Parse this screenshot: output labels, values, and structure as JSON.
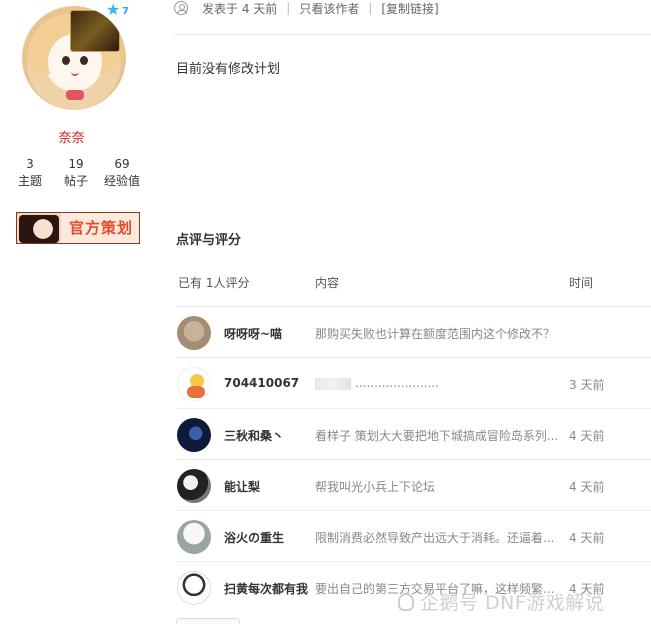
{
  "author": {
    "name": "奈奈",
    "level": "7",
    "stats": [
      {
        "value": "3",
        "label": "主题"
      },
      {
        "value": "19",
        "label": "帖子"
      },
      {
        "value": "69",
        "label": "经验值"
      }
    ],
    "medal_text": "官方策划"
  },
  "post": {
    "meta": {
      "posted": "发表于 4 天前",
      "only_author": "只看该作者",
      "copy_link": "[复制链接]"
    },
    "body": "目前没有修改计划"
  },
  "ratings": {
    "title": "点评与评分",
    "headers": {
      "count": "已有 1人评分",
      "content": "内容",
      "time": "时间"
    },
    "rows": [
      {
        "name": "呀呀呀~喵",
        "content": "那购买失败也计算在额度范围内这个修改不？",
        "time": ""
      },
      {
        "name": "704410067",
        "content": "......................",
        "time": "3 天前"
      },
      {
        "name": "三秋和桑丶",
        "content": "看样子 策划大大要把地下城搞成冒险岛系列...",
        "time": "4 天前"
      },
      {
        "name": "能让梨",
        "content": "帮我叫光小兵上下论坛",
        "time": "4 天前"
      },
      {
        "name": "浴火の重生",
        "content": "限制消费必然导致产出远大于消耗。还逼着...",
        "time": "4 天前"
      },
      {
        "name": "扫黄每次都有我",
        "content": "要出自己的第三方交易平台了嘛，这样频繁...",
        "time": "4 天前"
      }
    ]
  },
  "watermark": "企鹅号 DNF游戏解说"
}
